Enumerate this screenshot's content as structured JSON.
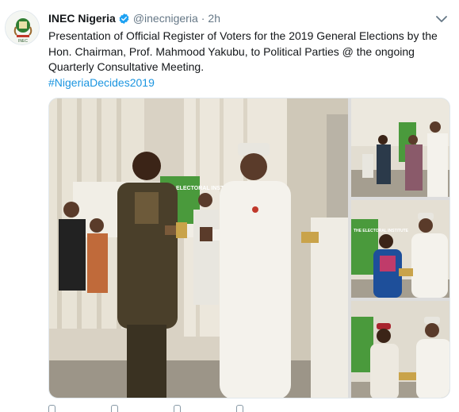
{
  "tweet": {
    "author_name": "INEC Nigeria",
    "handle": "@inecnigeria",
    "separator": "·",
    "time": "2h",
    "text": "Presentation of Official Register of Voters for the 2019 General Elections by the Hon. Chairman, Prof. Mahmood Yakubu, to Political Parties @ the ongoing Quarterly Consultative Meeting.",
    "hashtag": "#NigeriaDecides2019",
    "verified": true
  },
  "avatar": {
    "icon": "inec-logo-icon",
    "logo_text": "INEC"
  },
  "colors": {
    "link": "#1b95e0",
    "secondary_text": "#657786",
    "verified_badge": "#1da1f2",
    "banner_green": "#4a9a3c"
  },
  "media": {
    "photo_count": 4,
    "banner_text_main": "THE ELECTORAL INSTITUTE",
    "banner_text_side": "THE ELECTORAL INSTITUTE"
  },
  "icons": {
    "caret": "chevron-down-icon",
    "verified": "verified-badge-icon",
    "reply": "reply-icon",
    "retweet": "retweet-icon",
    "like": "like-icon",
    "share": "share-icon"
  }
}
